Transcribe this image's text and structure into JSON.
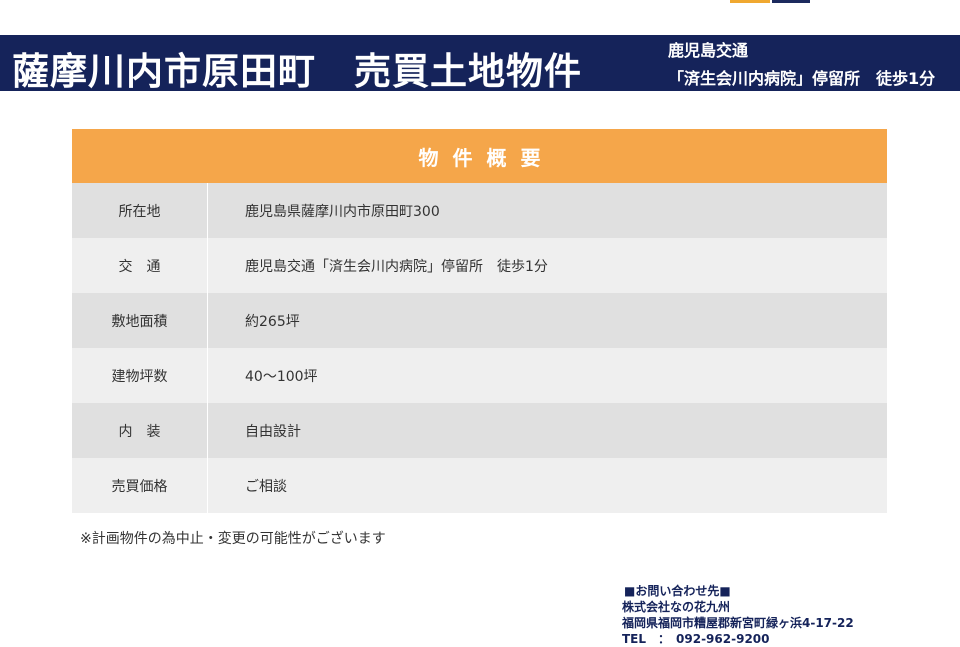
{
  "banner": {
    "title": "薩摩川内市原田町　売買土地物件",
    "transport_line1": "鹿児島交通",
    "transport_line2": "「済生会川内病院」停留所　徒歩1分"
  },
  "table": {
    "header": "物件概要",
    "rows": [
      {
        "label": "所在地",
        "value": "鹿児島県薩摩川内市原田町300"
      },
      {
        "label": "交　通",
        "value": "鹿児島交通「済生会川内病院」停留所　徒歩1分"
      },
      {
        "label": "敷地面積",
        "value": "約265坪"
      },
      {
        "label": "建物坪数",
        "value": "40〜100坪"
      },
      {
        "label": "内　装",
        "value": "自由設計"
      },
      {
        "label": "売買価格",
        "value": "ご相談"
      }
    ]
  },
  "note": "※計画物件の為中止・変更の可能性がございます",
  "contact": {
    "heading": "■お問い合わせ先■",
    "company": "株式会社なの花九州",
    "address": "福岡県福岡市糟屋郡新宮町緑ヶ浜4-17-22",
    "tel": "TEL　：　092-962-9200"
  },
  "colors": {
    "banner_bg": "#15235a",
    "header_bg": "#f5a64a",
    "row_dark": "#e0e0e0",
    "row_light": "#efefef"
  }
}
